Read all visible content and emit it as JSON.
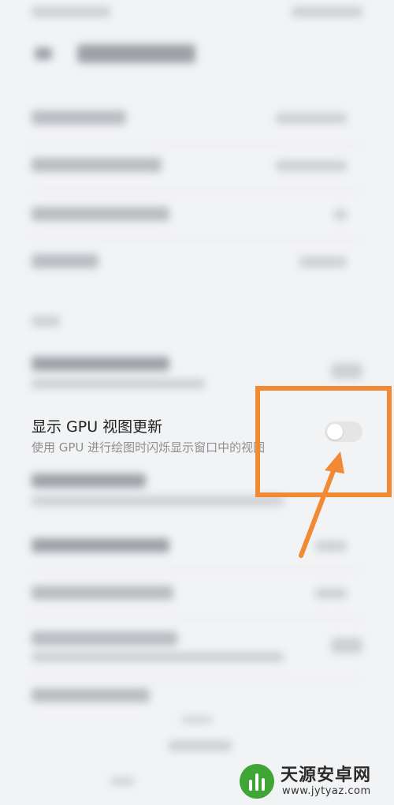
{
  "focused_setting": {
    "title": "显示 GPU 视图更新",
    "subtitle": "使用 GPU 进行绘图时闪烁显示窗口中的视图",
    "toggle_on": false
  },
  "watermark": {
    "site_name": "天源安卓网",
    "url": "www.jytyaz.com"
  },
  "colors": {
    "highlight": "#f08a34",
    "toggle_off": "#e5e5e5",
    "background": "#f2f3f5"
  }
}
